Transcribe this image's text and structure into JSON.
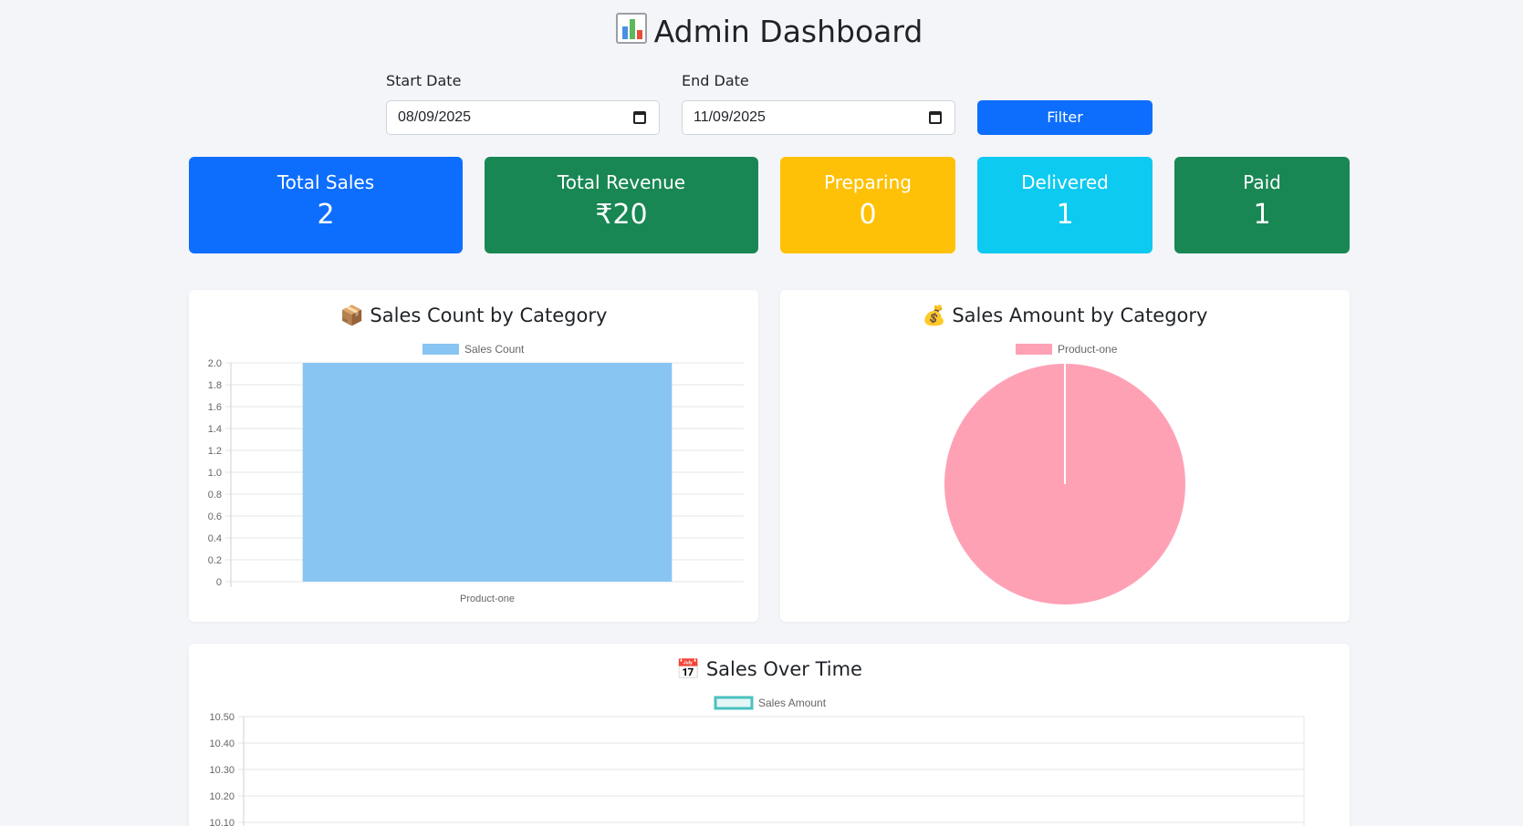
{
  "header": {
    "title": "Admin Dashboard",
    "icon": "bar-chart-emoji"
  },
  "filter": {
    "start_label": "Start Date",
    "start_value": "08/09/2025",
    "end_label": "End Date",
    "end_value": "11/09/2025",
    "button_label": "Filter"
  },
  "stats": [
    {
      "label": "Total Sales",
      "value": "2",
      "color": "#0d6efd"
    },
    {
      "label": "Total Revenue",
      "value": "₹20",
      "color": "#198754"
    },
    {
      "label": "Preparing",
      "value": "0",
      "color": "#ffc107"
    },
    {
      "label": "Delivered",
      "value": "1",
      "color": "#0dcaf0"
    },
    {
      "label": "Paid",
      "value": "1",
      "color": "#198754"
    }
  ],
  "panels": {
    "count": {
      "title": "📦 Sales Count by Category"
    },
    "amount": {
      "title": "💰 Sales Amount by Category"
    },
    "time": {
      "title": "📅 Sales Over Time"
    }
  },
  "chart_data": [
    {
      "type": "bar",
      "title": "Sales Count by Category",
      "categories": [
        "Product-one"
      ],
      "series": [
        {
          "name": "Sales Count",
          "values": [
            2
          ]
        }
      ],
      "ylim": [
        0,
        2.0
      ],
      "yticks": [
        "2.0",
        "1.8",
        "1.6",
        "1.4",
        "1.2",
        "1.0",
        "0.8",
        "0.6",
        "0.4",
        "0.2",
        "0"
      ],
      "color": "#88c5f2",
      "grid": true,
      "legend": "top"
    },
    {
      "type": "pie",
      "title": "Sales Amount by Category",
      "labels": [
        "Product-one"
      ],
      "values": [
        20
      ],
      "color": "#ffa1b5",
      "legend": "top"
    },
    {
      "type": "line",
      "title": "Sales Over Time",
      "series": [
        {
          "name": "Sales Amount",
          "values": []
        }
      ],
      "yticks": [
        "10.50",
        "10.40",
        "10.30",
        "10.20",
        "10.10"
      ],
      "ylim": [
        10.1,
        10.5
      ],
      "color": "#4bc0c0",
      "grid": true,
      "legend": "top"
    }
  ]
}
